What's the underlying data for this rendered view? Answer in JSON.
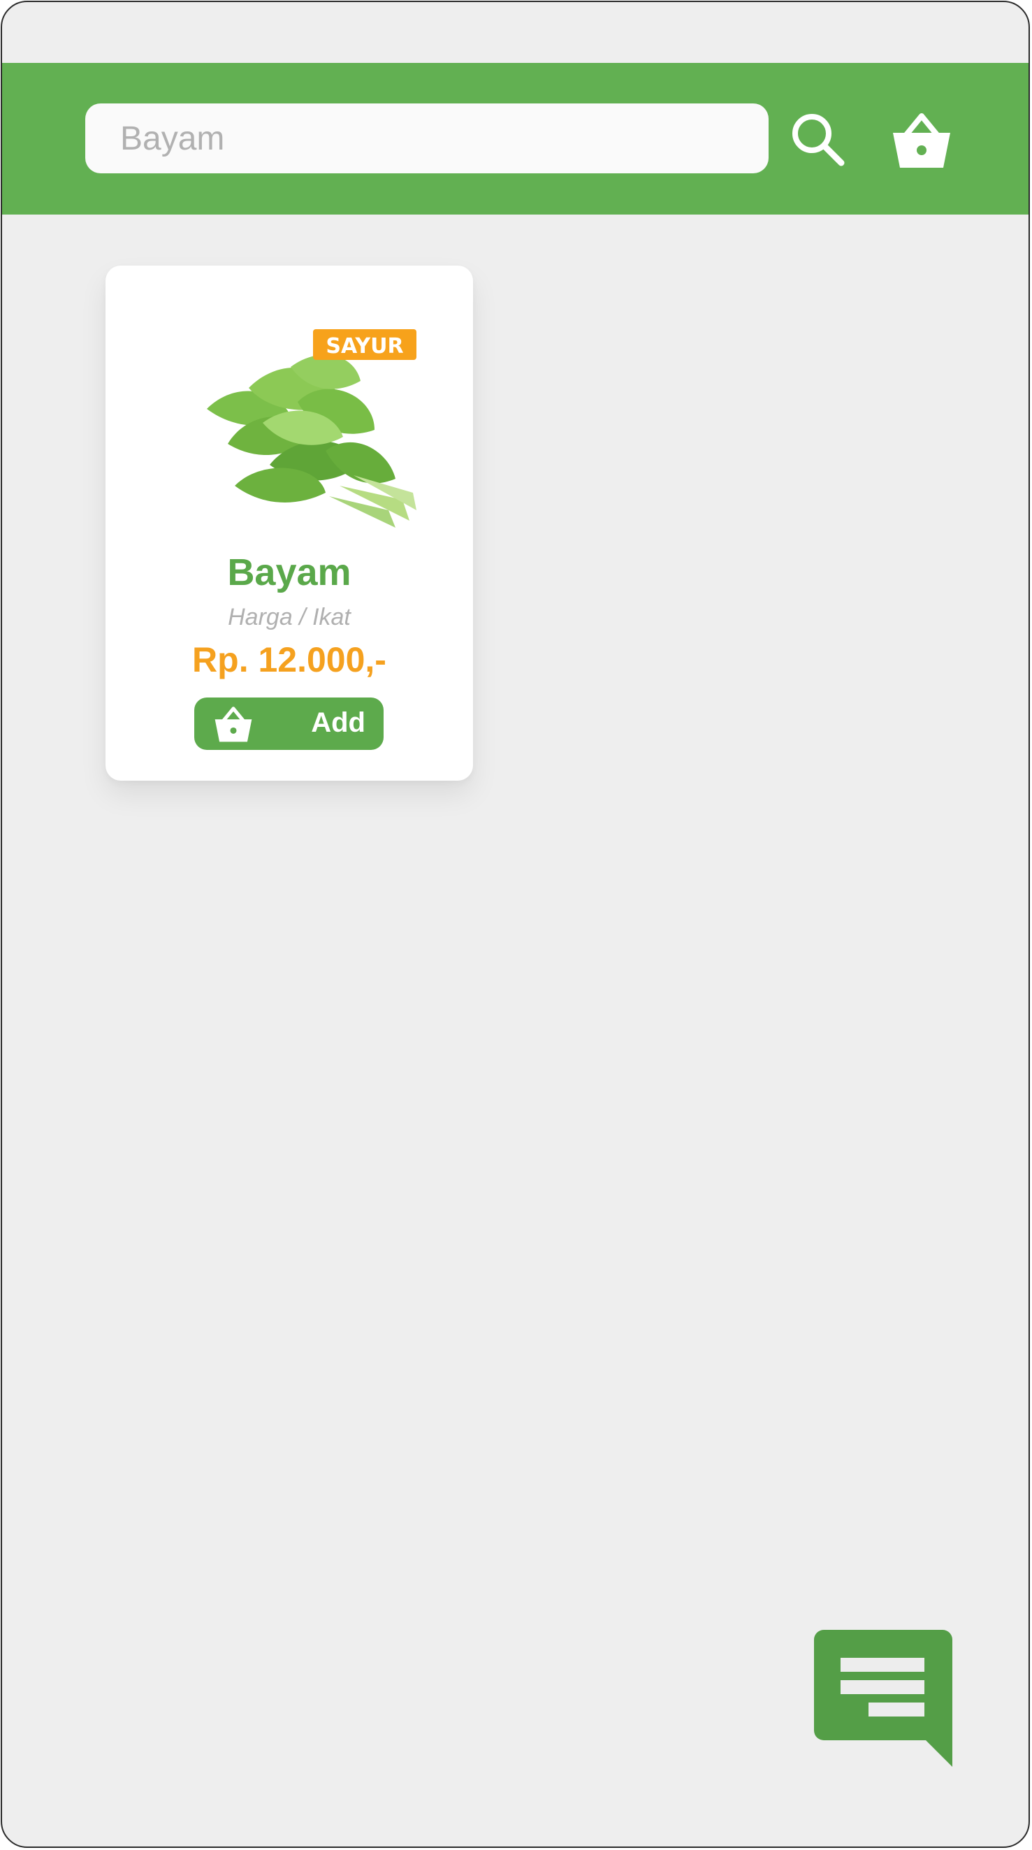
{
  "search": {
    "value": "Bayam",
    "placeholder": "Bayam"
  },
  "header": {
    "search_icon": "search-icon",
    "cart_icon": "basket-icon"
  },
  "product": {
    "name": "Bayam",
    "unit": "Harga / Ikat",
    "price": "Rp. 12.000,-",
    "add_label": "Add",
    "add_icon": "basket-icon",
    "image_logo_text": "SAYUR"
  },
  "chat": {
    "icon": "chat-icon"
  },
  "colors": {
    "brand_green": "#62b052",
    "button_green": "#5daa4c",
    "price_orange": "#f5a11f",
    "background": "#eeeeee",
    "chat_green": "#549e47"
  }
}
